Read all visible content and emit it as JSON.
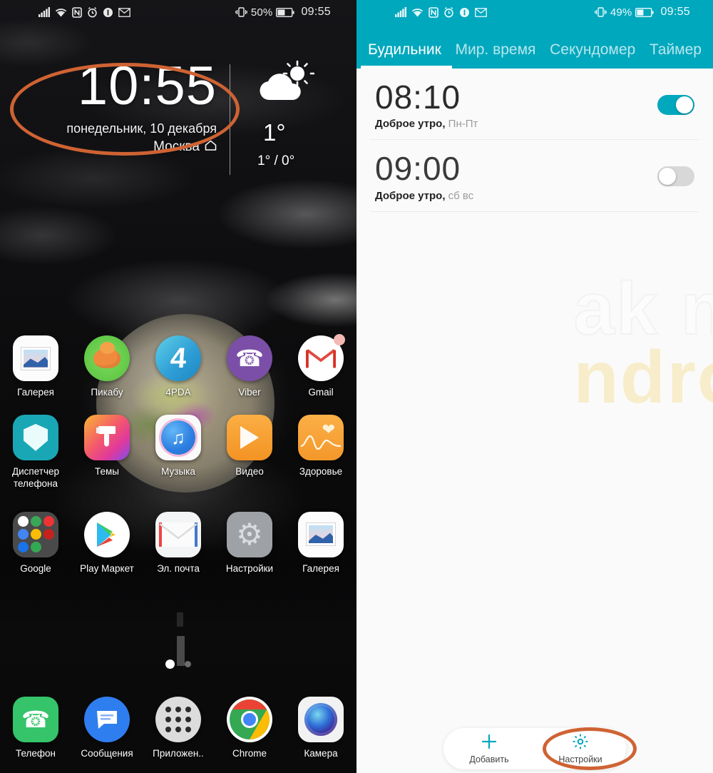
{
  "home": {
    "statusbar": {
      "icons": [
        "signal-icon",
        "wifi-icon",
        "nfc-icon",
        "alarm-icon",
        "info-icon",
        "gmail-icon"
      ],
      "vibrate_icon": "vibrate-icon",
      "battery_percent": "50%",
      "clock": "09:55"
    },
    "widget": {
      "time": "10:55",
      "date": "понедельник, 10 декабря",
      "city": "Москва",
      "home_icon": "home-icon",
      "weather_icon": "partly-cloudy-icon",
      "temp": "1°",
      "temp_range": "1° / 0°"
    },
    "highlight_color": "#cf6333",
    "rows": [
      [
        {
          "label": "Галерея",
          "icon": "gallery-icon"
        },
        {
          "label": "Пикабу",
          "icon": "pikabu-icon"
        },
        {
          "label": "4PDA",
          "icon": "fourpda-icon"
        },
        {
          "label": "Viber",
          "icon": "viber-icon"
        },
        {
          "label": "Gmail",
          "icon": "gmail-icon",
          "badge": true
        }
      ],
      [
        {
          "label": "Диспетчер телефона",
          "icon": "phone-manager-icon"
        },
        {
          "label": "Темы",
          "icon": "themes-icon"
        },
        {
          "label": "Музыка",
          "icon": "music-icon"
        },
        {
          "label": "Видео",
          "icon": "video-icon"
        },
        {
          "label": "Здоровье",
          "icon": "health-icon"
        }
      ],
      [
        {
          "label": "Google",
          "icon": "google-folder-icon"
        },
        {
          "label": "Play Маркет",
          "icon": "play-store-icon"
        },
        {
          "label": "Эл. почта",
          "icon": "email-icon"
        },
        {
          "label": "Настройки",
          "icon": "settings-icon"
        },
        {
          "label": "Галерея",
          "icon": "gallery-icon"
        }
      ]
    ],
    "dock": [
      {
        "label": "Телефон",
        "icon": "phone-icon"
      },
      {
        "label": "Сообщения",
        "icon": "messages-icon"
      },
      {
        "label": "Приложен..",
        "icon": "app-drawer-icon"
      },
      {
        "label": "Chrome",
        "icon": "chrome-icon"
      },
      {
        "label": "Камера",
        "icon": "camera-icon"
      }
    ],
    "page_indicator": {
      "pages": 2,
      "active": 0
    }
  },
  "clockapp": {
    "accent_color": "#00a8bd",
    "statusbar": {
      "icons": [
        "signal-icon",
        "wifi-icon",
        "nfc-icon",
        "alarm-icon",
        "info-icon",
        "gmail-icon"
      ],
      "vibrate_icon": "vibrate-icon",
      "battery_percent": "49%",
      "clock": "09:55"
    },
    "tabs": [
      {
        "label": "Будильник",
        "active": true
      },
      {
        "label": "Мир. время",
        "active": false
      },
      {
        "label": "Секундомер",
        "active": false
      },
      {
        "label": "Таймер",
        "active": false
      }
    ],
    "alarms": [
      {
        "time": "08:10",
        "name": "Доброе утро,",
        "days": "Пн-Пт",
        "enabled": true
      },
      {
        "time": "09:00",
        "name": "Доброе утро,",
        "days": "сб вс",
        "enabled": false
      }
    ],
    "watermark_line1": "ak na",
    "watermark_line2": "ndroid",
    "bottom_bar": [
      {
        "label": "Добавить",
        "icon": "plus-icon"
      },
      {
        "label": "Настройки",
        "icon": "gear-icon"
      }
    ],
    "highlight_color": "#cf6333"
  }
}
